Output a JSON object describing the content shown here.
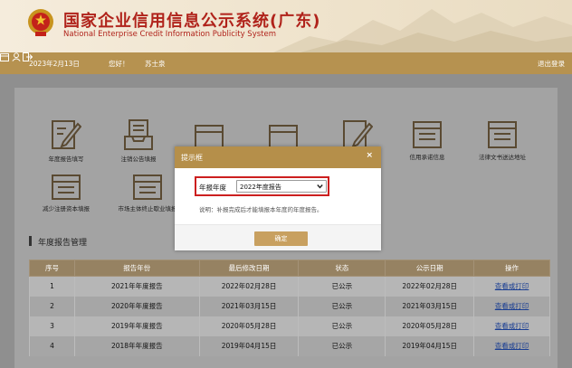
{
  "header": {
    "title": "国家企业信用信息公示系统(广东)",
    "subtitle": "National Enterprise Credit Information Publicity System"
  },
  "infobar": {
    "date": "2023年2月13日",
    "greeting": "您好！",
    "username": "苏士泉",
    "logout": "退出登录"
  },
  "tiles": [
    {
      "label": "年度报告填写",
      "icon": "edit-form-icon"
    },
    {
      "label": "注销公告填报",
      "icon": "inbox-document-icon"
    },
    {
      "label": "信用承诺信息",
      "icon": "document-list-icon"
    },
    {
      "label": "法律文书送达地址",
      "icon": "document-list-icon"
    },
    {
      "label": "减少注册资本填报",
      "icon": "document-list-icon"
    },
    {
      "label": "市场主体终止歇业填报",
      "icon": "document-list-icon"
    }
  ],
  "section": {
    "title": "年度报告管理"
  },
  "table": {
    "headers": [
      "序号",
      "报告年份",
      "最后修改日期",
      "状态",
      "公示日期",
      "操作"
    ],
    "rows": [
      [
        "1",
        "2021年年度报告",
        "2022年02月28日",
        "已公示",
        "2022年02月28日",
        "查看或打印"
      ],
      [
        "2",
        "2020年年度报告",
        "2021年03月15日",
        "已公示",
        "2021年03月15日",
        "查看或打印"
      ],
      [
        "3",
        "2019年年度报告",
        "2020年05月28日",
        "已公示",
        "2020年05月28日",
        "查看或打印"
      ],
      [
        "4",
        "2018年年度报告",
        "2019年04月15日",
        "已公示",
        "2019年04月15日",
        "查看或打印"
      ]
    ]
  },
  "modal": {
    "title": "提示框",
    "close": "×",
    "field_label": "年报年度",
    "selected_option": "2022年度报告",
    "note": "说明：补报完成后才能填报本年度的年度报告。",
    "ok_label": "确定"
  },
  "colors": {
    "brand_red": "#b0231b",
    "gold_bar": "#b69250",
    "modal_header": "#b58f4a",
    "highlight": "#cc1f1f",
    "link": "#1b3f93"
  }
}
